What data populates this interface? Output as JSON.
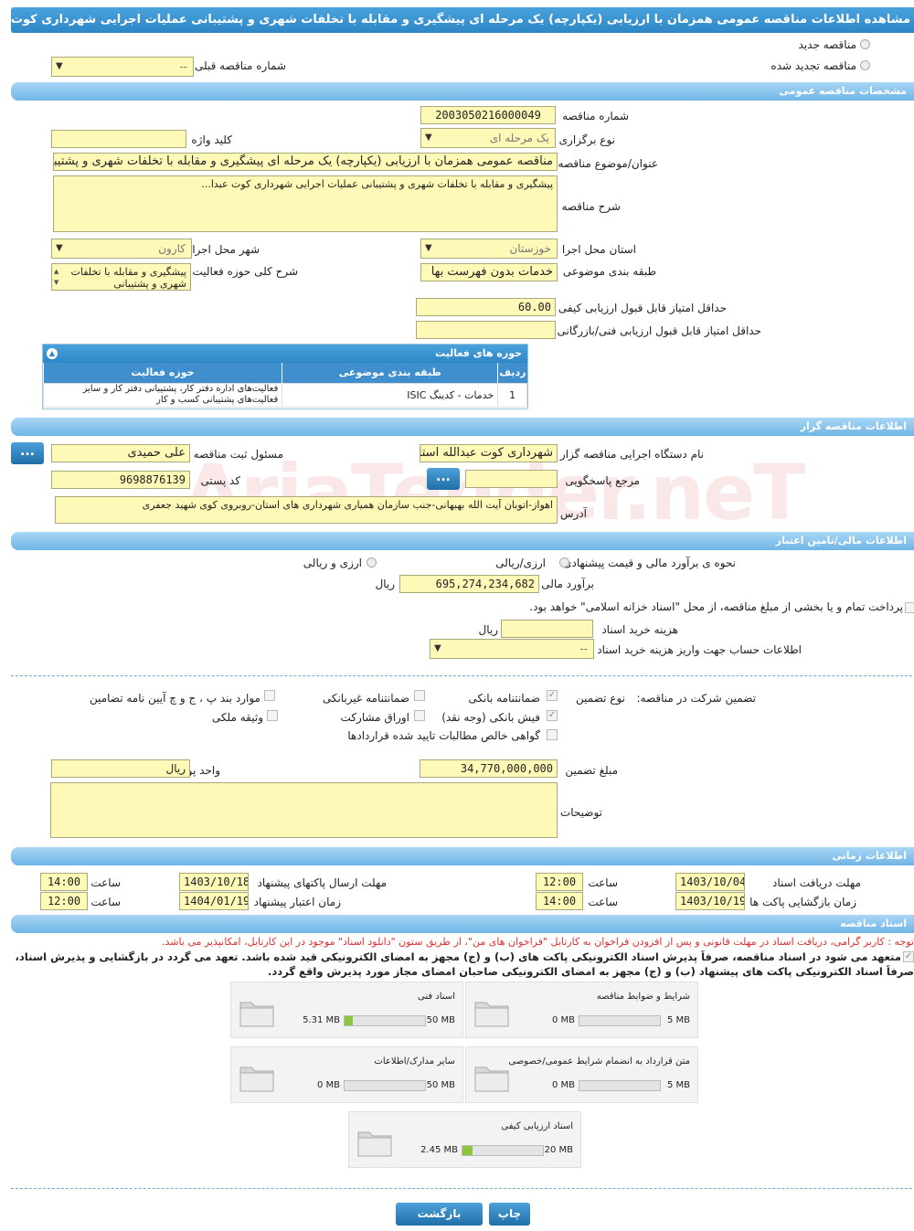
{
  "header": {
    "title": "مشاهده اطلاعات مناقصه عمومی همزمان با ارزیابی (یکپارچه) یک مرحله ای پیشگیری و مقابله با تخلفات شهری و پشتیبانی عملیات اجرایی شهرداری کوت عبدا..."
  },
  "top": {
    "new_tender": "مناقصه جدید",
    "renewed_tender": "مناقصه تجدید شده",
    "prev_tender_no_label": "شماره مناقصه قبلی",
    "prev_tender_no_value": "--"
  },
  "general": {
    "section_title": "مشخصات مناقصه عمومی",
    "tender_no_label": "شماره مناقصه",
    "tender_no": "2003050216000049",
    "holding_type_label": "نوع برگزاری",
    "holding_type": "یک مرحله ای",
    "keyword_label": "کلید واژه",
    "keyword": "",
    "subject_label": "عنوان/موضوع مناقصه",
    "subject": "مناقصه عمومی همزمان با ارزیابی (یکپارچه) یک مرحله ای پیشگیری و مقابله با تخلفات شهری و پشتیبانی",
    "description_label": "شرح مناقصه",
    "description": "پیشگیری و مقابله با تخلفات شهری و پشتیبانی عملیات اجرایی شهرداری کوت عبدا...",
    "province_label": "استان محل اجرا",
    "province": "خوزستان",
    "city_label": "شهر محل اجرا",
    "city": "کارون",
    "category_label": "طبقه بندی موضوعی",
    "category": "خدمات بدون فهرست بها",
    "activity_desc_label": "شرح کلی حوزه فعالیت",
    "activity_desc": "پیشگیری و مقابله با تخلفات شهری و پشتیبانی",
    "min_quality_label": "حداقل امتیاز قابل قبول ارزیابی کیفی",
    "min_quality": "60.00",
    "min_tech_label": "حداقل امتیاز قابل قبول ارزیابی فنی/بازرگانی",
    "min_tech": ""
  },
  "activities": {
    "title": "حوزه های فعالیت",
    "headers": [
      "ردیف",
      "طبقه بندی موضوعی",
      "حوزه فعالیت"
    ],
    "rows": [
      {
        "no": "1",
        "category": "خدمات - کدینگ ISIC",
        "field": "فعالیت‌های اداره دفتر کار، پشتیبانی دفتر کار و سایر فعالیت‌های پشتیبانی کسب و کار"
      }
    ]
  },
  "organizer": {
    "section_title": "اطلاعات مناقصه گزار",
    "org_name_label": "نام دستگاه اجرایی مناقصه گزار",
    "org_name": "شهرداری کوت عبدالله استان",
    "registrar_label": "مسئول ثبت مناقصه",
    "registrar": "علی حمیدی",
    "reference_label": "مرجع پاسخگویی",
    "reference": "",
    "postal_label": "کد پستی",
    "postal": "9698876139",
    "address_label": "آدرس",
    "address": "اهواز-اتوبان آیت الله بهبهانی-جنب سازمان همیاری شهرداری های استان-روبروی کوی شهید جعفری",
    "dots": "..."
  },
  "financial": {
    "section_title": "اطلاعات مالی/تامین اعتبار",
    "estimate_type_label": "نحوه ی برآورد مالی و قیمت پیشنهادی",
    "opt_rial_fx": "ارزی/ریالی",
    "opt_fx_and_rial": "ارزی و ریالی",
    "estimate_label": "برآورد مالی",
    "estimate": "695,274,234,682",
    "currency": "ریال",
    "treasury_note": "پرداخت تمام و یا بخشی از مبلغ مناقصه، از محل \"اسناد خزانه اسلامی\" خواهد بود.",
    "doc_fee_label": "هزینه خرید اسناد",
    "doc_fee": "",
    "doc_fee_unit": "ریال",
    "account_label": "اطلاعات حساب جهت واریز هزینه خرید اسناد",
    "account": "--"
  },
  "guarantee": {
    "title_label": "تضمین شرکت در مناقصه:",
    "type_label": "نوع تضمین",
    "items": {
      "bank_guarantee": "ضمانتنامه بانکی",
      "nonbank_guarantee": "ضمانتنامه غیربانکی",
      "clauses": "موارد بند پ ، ج و چ آیین نامه تضامین",
      "bank_receipt": "فیش بانکی (وجه نقد)",
      "bonds": "اوراق مشارکت",
      "property": "وثیقه ملکی",
      "claims": "گواهی خالص مطالبات تایید شده قراردادها"
    },
    "amount_label": "مبلغ تضمین",
    "amount": "34,770,000,000",
    "unit_label": "واحد پول",
    "unit": "ریال",
    "notes_label": "توضیحات",
    "notes": ""
  },
  "timing": {
    "section_title": "اطلاعات زمانی",
    "receive_deadline_label": "مهلت دریافت اسناد",
    "receive_deadline_date": "1403/10/04",
    "receive_deadline_time": "12:00",
    "send_deadline_label": "مهلت ارسال پاکتهای پیشنهاد",
    "send_deadline_date": "1403/10/18",
    "send_deadline_time": "14:00",
    "opening_label": "زمان بازگشایی پاکت ها",
    "opening_date": "1403/10/19",
    "opening_time": "14:00",
    "validity_label": "زمان اعتبار پیشنهاد",
    "validity_date": "1404/01/19",
    "validity_time": "12:00",
    "time_label": "ساعت"
  },
  "documents": {
    "section_title": "اسناد مناقصه",
    "notice": "توجه : کاربر گرامی، دریافت اسناد در مهلت قانونی و پس از افزودن فراخوان به کارتابل \"فراخوان های من\"، از طریق ستون \"دانلود اسناد\" موجود در این کارتابل، امکانپذیر می باشد.",
    "commit_1": "متعهد می شود در اسناد مناقصه، صرفاً پذیرش اسناد الکترونیکی پاکت های (ب) و (ج) مجهز به امضای الکترونیکی قید شده باشد. تعهد می گردد در بازگشایی و پذیرش اسناد،",
    "commit_2": "صرفاً اسناد الکترونیکی پاکت های پیشنهاد (ب) و (ج) مجهز به امضای الکترونیکی صاحبان امضای مجاز مورد پذیرش واقع گردد.",
    "files": [
      {
        "name": "شرایط و ضوابط مناقصه",
        "current": "0 MB",
        "max": "5 MB",
        "fraction": 0
      },
      {
        "name": "اسناد فنی",
        "current": "5.31 MB",
        "max": "50 MB",
        "fraction": 0.106
      },
      {
        "name": "متن قرارداد به انضمام شرایط عمومی/خصوصی",
        "current": "0 MB",
        "max": "5 MB",
        "fraction": 0
      },
      {
        "name": "سایر مدارک/اطلاعات",
        "current": "0 MB",
        "max": "50 MB",
        "fraction": 0
      },
      {
        "name": "اسناد ارزیابی کیفی",
        "current": "2.45 MB",
        "max": "20 MB",
        "fraction": 0.1225
      }
    ]
  },
  "actions": {
    "print": "چاپ",
    "back": "بازگشت"
  },
  "watermark": "AriaTender.neT"
}
